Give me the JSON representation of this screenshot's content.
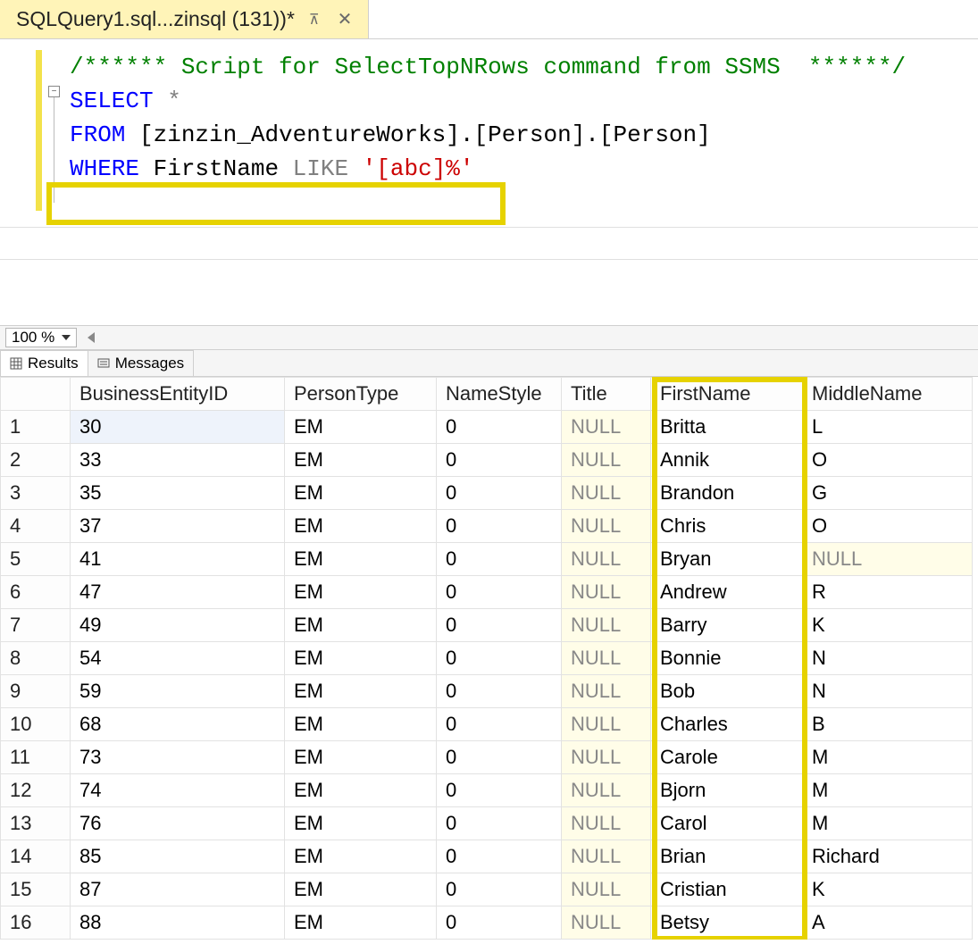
{
  "tab": {
    "title": "SQLQuery1.sql...zinsql (131))*",
    "pin_glyph": "⊼",
    "close_glyph": "✕"
  },
  "editor": {
    "comment": "/****** Script for SelectTopNRows command from SSMS  ******/",
    "kw_select": "SELECT",
    "star": " *",
    "kw_from": "FROM",
    "from_rest": " [zinzin_AdventureWorks].[Person].[Person]",
    "kw_where": "WHERE",
    "where_col": " FirstName ",
    "kw_like": "LIKE",
    "where_str": " '[abc]%'",
    "collapse_glyph": "−"
  },
  "zoom": {
    "value": "100 %"
  },
  "result_tabs": {
    "results": "Results",
    "messages": "Messages"
  },
  "columns": {
    "rownum_w": 78,
    "names": [
      "BusinessEntityID",
      "PersonType",
      "NameStyle",
      "Title",
      "FirstName",
      "MiddleName"
    ],
    "widths": [
      240,
      170,
      140,
      100,
      170,
      190
    ]
  },
  "null_text": "NULL",
  "rows": [
    {
      "n": "1",
      "BusinessEntityID": "30",
      "PersonType": "EM",
      "NameStyle": "0",
      "Title": null,
      "FirstName": "Britta",
      "MiddleName": "L"
    },
    {
      "n": "2",
      "BusinessEntityID": "33",
      "PersonType": "EM",
      "NameStyle": "0",
      "Title": null,
      "FirstName": "Annik",
      "MiddleName": "O"
    },
    {
      "n": "3",
      "BusinessEntityID": "35",
      "PersonType": "EM",
      "NameStyle": "0",
      "Title": null,
      "FirstName": "Brandon",
      "MiddleName": "G"
    },
    {
      "n": "4",
      "BusinessEntityID": "37",
      "PersonType": "EM",
      "NameStyle": "0",
      "Title": null,
      "FirstName": "Chris",
      "MiddleName": "O"
    },
    {
      "n": "5",
      "BusinessEntityID": "41",
      "PersonType": "EM",
      "NameStyle": "0",
      "Title": null,
      "FirstName": "Bryan",
      "MiddleName": null
    },
    {
      "n": "6",
      "BusinessEntityID": "47",
      "PersonType": "EM",
      "NameStyle": "0",
      "Title": null,
      "FirstName": "Andrew",
      "MiddleName": "R"
    },
    {
      "n": "7",
      "BusinessEntityID": "49",
      "PersonType": "EM",
      "NameStyle": "0",
      "Title": null,
      "FirstName": "Barry",
      "MiddleName": "K"
    },
    {
      "n": "8",
      "BusinessEntityID": "54",
      "PersonType": "EM",
      "NameStyle": "0",
      "Title": null,
      "FirstName": "Bonnie",
      "MiddleName": "N"
    },
    {
      "n": "9",
      "BusinessEntityID": "59",
      "PersonType": "EM",
      "NameStyle": "0",
      "Title": null,
      "FirstName": "Bob",
      "MiddleName": "N"
    },
    {
      "n": "10",
      "BusinessEntityID": "68",
      "PersonType": "EM",
      "NameStyle": "0",
      "Title": null,
      "FirstName": "Charles",
      "MiddleName": "B"
    },
    {
      "n": "11",
      "BusinessEntityID": "73",
      "PersonType": "EM",
      "NameStyle": "0",
      "Title": null,
      "FirstName": "Carole",
      "MiddleName": "M"
    },
    {
      "n": "12",
      "BusinessEntityID": "74",
      "PersonType": "EM",
      "NameStyle": "0",
      "Title": null,
      "FirstName": "Bjorn",
      "MiddleName": "M"
    },
    {
      "n": "13",
      "BusinessEntityID": "76",
      "PersonType": "EM",
      "NameStyle": "0",
      "Title": null,
      "FirstName": "Carol",
      "MiddleName": "M"
    },
    {
      "n": "14",
      "BusinessEntityID": "85",
      "PersonType": "EM",
      "NameStyle": "0",
      "Title": null,
      "FirstName": "Brian",
      "MiddleName": "Richard"
    },
    {
      "n": "15",
      "BusinessEntityID": "87",
      "PersonType": "EM",
      "NameStyle": "0",
      "Title": null,
      "FirstName": "Cristian",
      "MiddleName": "K"
    },
    {
      "n": "16",
      "BusinessEntityID": "88",
      "PersonType": "EM",
      "NameStyle": "0",
      "Title": null,
      "FirstName": "Betsy",
      "MiddleName": "A"
    }
  ]
}
